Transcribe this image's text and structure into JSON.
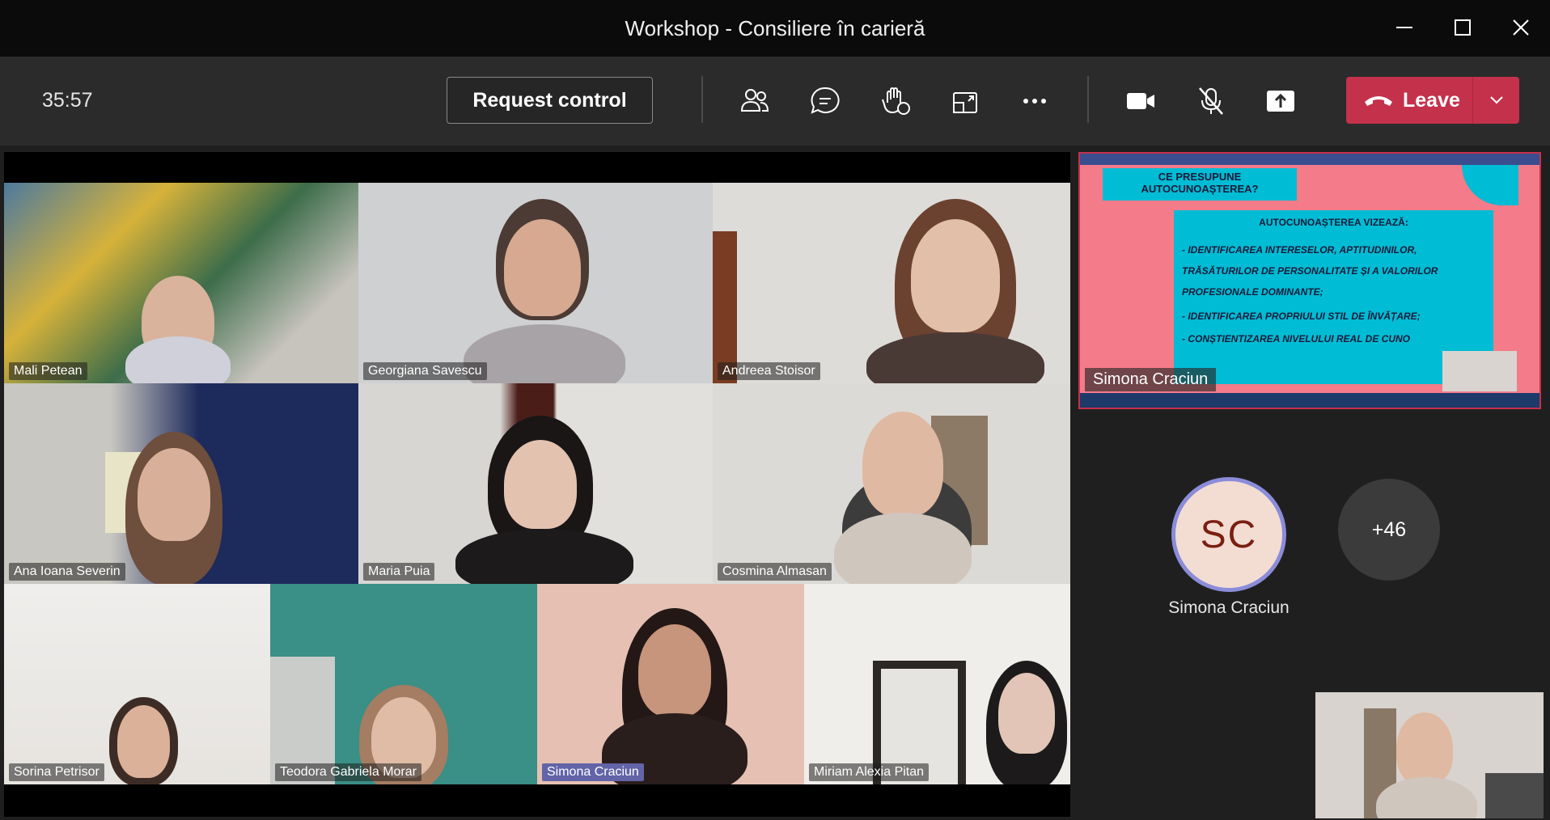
{
  "window": {
    "title": "Workshop - Consiliere în carieră"
  },
  "toolbar": {
    "timer": "35:57",
    "request_control_label": "Request control",
    "leave_label": "Leave"
  },
  "tiles": [
    {
      "name": "Mali Petean"
    },
    {
      "name": "Georgiana Savescu"
    },
    {
      "name": "Andreea Stoisor"
    },
    {
      "name": "Ana Ioana Severin"
    },
    {
      "name": "Maria   Puia"
    },
    {
      "name": "Cosmina Almasan"
    },
    {
      "name": "Sorina Petrisor"
    },
    {
      "name": "Teodora Gabriela Morar"
    },
    {
      "name": "Simona Craciun"
    },
    {
      "name": "Miriam Alexia Pitan"
    }
  ],
  "share": {
    "presenter": "Simona Craciun",
    "slide": {
      "heading": "CE PRESUPUNE AUTOCUNOAȘTEREA?",
      "box_title": "AUTOCUNOAȘTEREA VIZEAZĂ:",
      "line1": "- IDENTIFICAREA INTERESELOR, APTITUDINILOR, TRĂSĂTURILOR DE PERSONALITATE ȘI A VALORILOR PROFESIONALE DOMINANTE;",
      "line2": "- IDENTIFICAREA PROPRIULUI STIL DE ÎNVĂȚARE;",
      "line3": "- CONȘTIENTIZAREA NIVELULUI REAL DE CUNO"
    }
  },
  "roster": {
    "initials": "SC",
    "name": "Simona Craciun",
    "more_count": "+46"
  },
  "colors": {
    "leave": "#c4314b",
    "accent": "#6264a7",
    "avatar_ring": "#8b8cd9"
  }
}
